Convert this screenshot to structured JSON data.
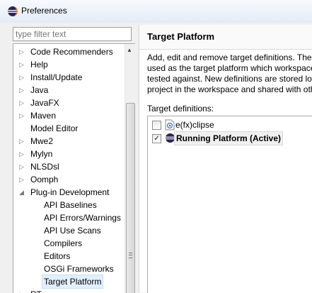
{
  "window": {
    "title": "Preferences"
  },
  "sidebar": {
    "filter_placeholder": "type filter text",
    "items": [
      {
        "label": "Code Recommenders",
        "expander": "collapsed",
        "indent": 0
      },
      {
        "label": "Help",
        "expander": "collapsed",
        "indent": 0
      },
      {
        "label": "Install/Update",
        "expander": "collapsed",
        "indent": 0
      },
      {
        "label": "Java",
        "expander": "collapsed",
        "indent": 0
      },
      {
        "label": "JavaFX",
        "expander": "collapsed",
        "indent": 0
      },
      {
        "label": "Maven",
        "expander": "collapsed",
        "indent": 0
      },
      {
        "label": "Model Editor",
        "expander": "none",
        "indent": 0
      },
      {
        "label": "Mwe2",
        "expander": "collapsed",
        "indent": 0
      },
      {
        "label": "Mylyn",
        "expander": "collapsed",
        "indent": 0
      },
      {
        "label": "NLSDsl",
        "expander": "collapsed",
        "indent": 0
      },
      {
        "label": "Oomph",
        "expander": "collapsed",
        "indent": 0
      },
      {
        "label": "Plug-in Development",
        "expander": "expanded",
        "indent": 0
      },
      {
        "label": "API Baselines",
        "expander": "none",
        "indent": 1
      },
      {
        "label": "API Errors/Warnings",
        "expander": "none",
        "indent": 1
      },
      {
        "label": "API Use Scans",
        "expander": "none",
        "indent": 1
      },
      {
        "label": "Compilers",
        "expander": "none",
        "indent": 1
      },
      {
        "label": "Editors",
        "expander": "none",
        "indent": 1
      },
      {
        "label": "OSGi Frameworks",
        "expander": "none",
        "indent": 1
      },
      {
        "label": "Target Platform",
        "expander": "none",
        "indent": 1,
        "selected": true
      },
      {
        "label": "RT...",
        "expander": "collapsed",
        "indent": 0
      }
    ]
  },
  "main": {
    "title": "Target Platform",
    "description_lines": [
      "Add, edit and remove target definitions.  The",
      "used as the target platform which workspace",
      "tested against.  New definitions are stored lo",
      "project in the workspace and shared with oth"
    ],
    "definitions_label": "Target definitions:",
    "definitions": [
      {
        "label": "e(fx)clipse",
        "checked": false,
        "active": false,
        "icon": "target-file-icon"
      },
      {
        "label": "Running Platform (Active)",
        "checked": true,
        "active": true,
        "icon": "eclipse-icon"
      }
    ]
  },
  "colors": {
    "selection_bg": "#e3efff",
    "eclipse_purple": "#2c2255"
  }
}
